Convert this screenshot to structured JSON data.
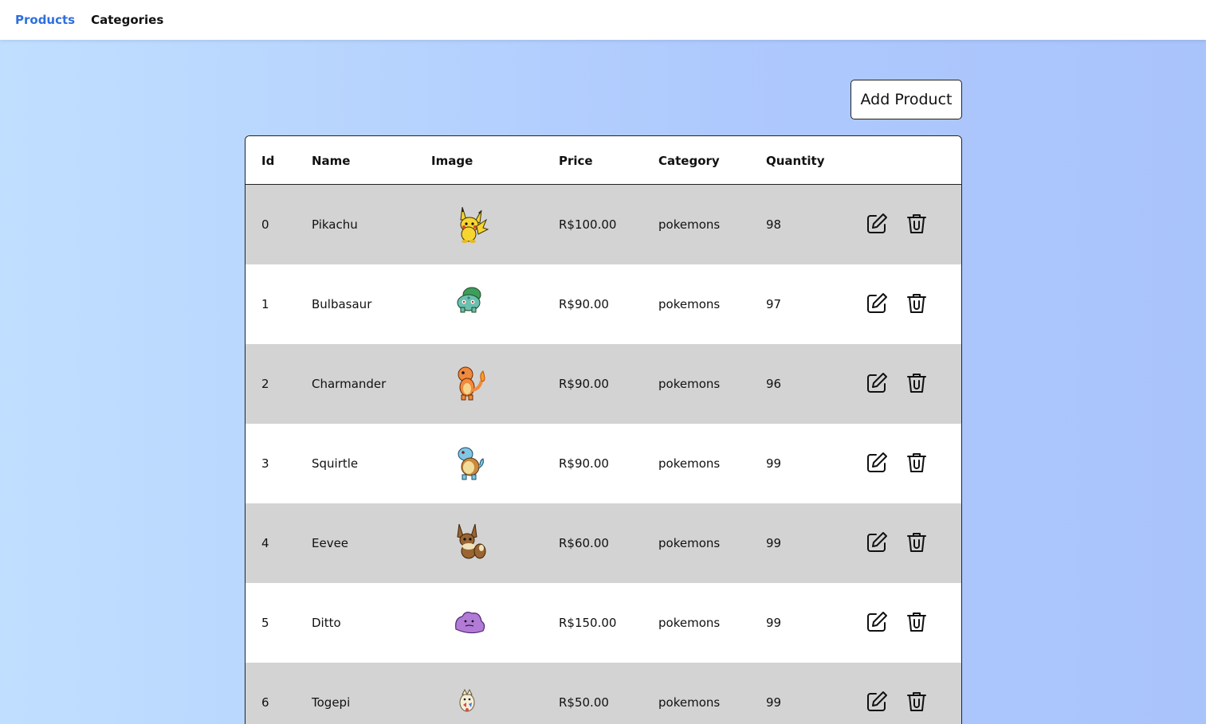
{
  "nav": {
    "products_label": "Products",
    "categories_label": "Categories"
  },
  "add_button_label": "Add Product",
  "table": {
    "headers": {
      "id": "Id",
      "name": "Name",
      "image": "Image",
      "price": "Price",
      "category": "Category",
      "quantity": "Quantity"
    },
    "rows": [
      {
        "id": "0",
        "name": "Pikachu",
        "price": "R$100.00",
        "category": "pokemons",
        "quantity": "98",
        "image_icon": "pikachu-sprite-icon"
      },
      {
        "id": "1",
        "name": "Bulbasaur",
        "price": "R$90.00",
        "category": "pokemons",
        "quantity": "97",
        "image_icon": "bulbasaur-sprite-icon"
      },
      {
        "id": "2",
        "name": "Charmander",
        "price": "R$90.00",
        "category": "pokemons",
        "quantity": "96",
        "image_icon": "charmander-sprite-icon"
      },
      {
        "id": "3",
        "name": "Squirtle",
        "price": "R$90.00",
        "category": "pokemons",
        "quantity": "99",
        "image_icon": "squirtle-sprite-icon"
      },
      {
        "id": "4",
        "name": "Eevee",
        "price": "R$60.00",
        "category": "pokemons",
        "quantity": "99",
        "image_icon": "eevee-sprite-icon"
      },
      {
        "id": "5",
        "name": "Ditto",
        "price": "R$150.00",
        "category": "pokemons",
        "quantity": "99",
        "image_icon": "ditto-sprite-icon"
      },
      {
        "id": "6",
        "name": "Togepi",
        "price": "R$50.00",
        "category": "pokemons",
        "quantity": "99",
        "image_icon": "togepi-sprite-icon"
      }
    ]
  },
  "colors": {
    "active_nav": "#2f6fde",
    "row_alt": "#d3d3d3"
  }
}
